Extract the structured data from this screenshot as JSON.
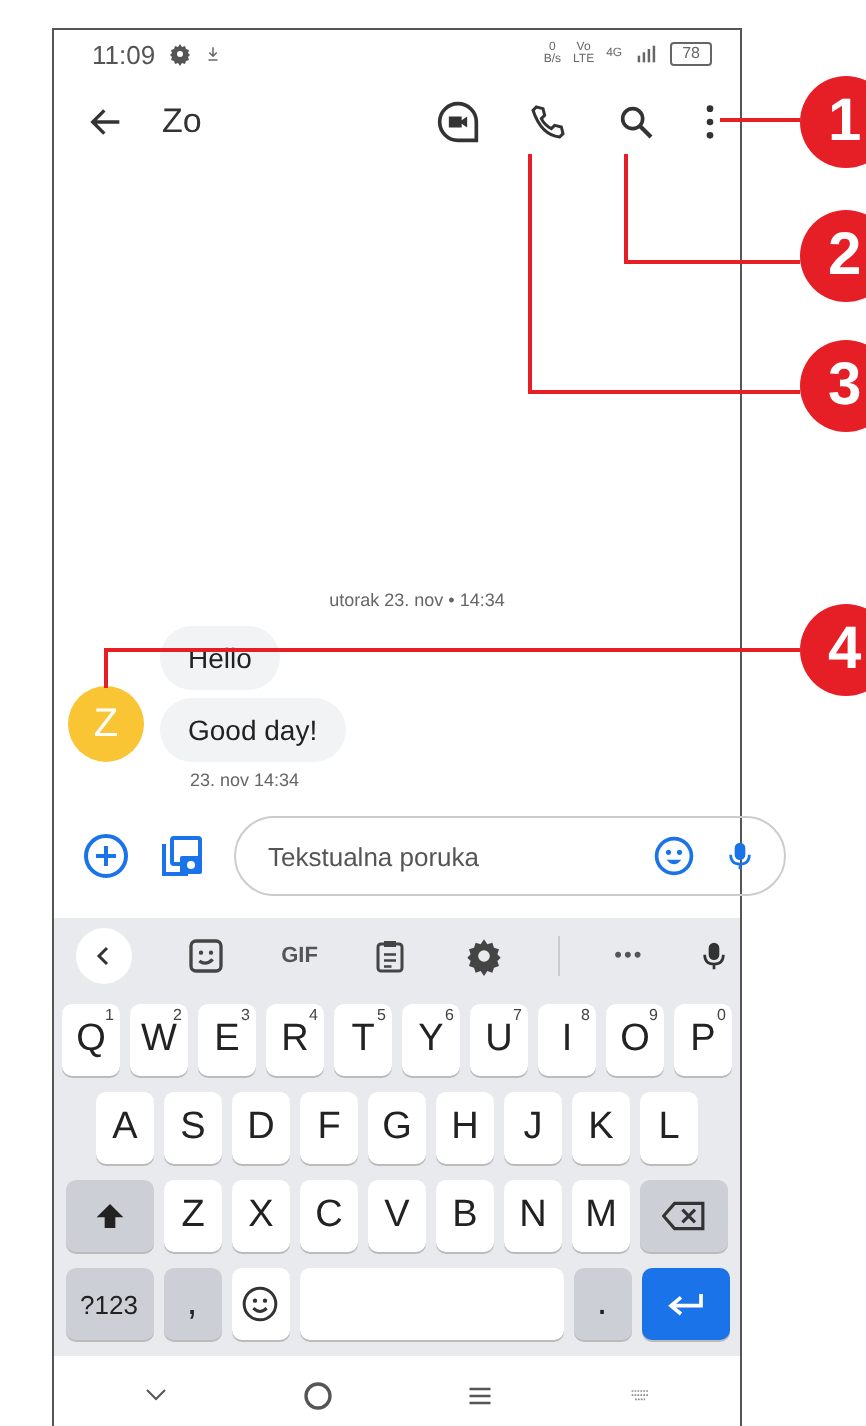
{
  "status_bar": {
    "time": "11:09",
    "speed": [
      "0",
      "B/s"
    ],
    "network": [
      "Vo",
      "LTE"
    ],
    "signal_tag": "4G",
    "battery": "78"
  },
  "app_bar": {
    "title": "Zo"
  },
  "conversation": {
    "date_divider": "utorak 23. nov • 14:34",
    "messages": [
      {
        "text": "Hello"
      },
      {
        "text": "Good day!"
      }
    ],
    "avatar": {
      "initial": "Z",
      "color": "#f9c534"
    },
    "timestamp": "23. nov 14:34"
  },
  "compose": {
    "placeholder": "Tekstualna poruka"
  },
  "keyboard": {
    "toolbar": {
      "gif": "GIF",
      "more": "•••"
    },
    "rows": [
      {
        "keys": [
          {
            "kind": "letter",
            "label": "Q",
            "hint": "1"
          },
          {
            "kind": "letter",
            "label": "W",
            "hint": "2"
          },
          {
            "kind": "letter",
            "label": "E",
            "hint": "3"
          },
          {
            "kind": "letter",
            "label": "R",
            "hint": "4"
          },
          {
            "kind": "letter",
            "label": "T",
            "hint": "5"
          },
          {
            "kind": "letter",
            "label": "Y",
            "hint": "6"
          },
          {
            "kind": "letter",
            "label": "U",
            "hint": "7"
          },
          {
            "kind": "letter",
            "label": "I",
            "hint": "8"
          },
          {
            "kind": "letter",
            "label": "O",
            "hint": "9"
          },
          {
            "kind": "letter",
            "label": "P",
            "hint": "0"
          }
        ]
      },
      {
        "keys": [
          {
            "kind": "letter",
            "label": "A"
          },
          {
            "kind": "letter",
            "label": "S"
          },
          {
            "kind": "letter",
            "label": "D"
          },
          {
            "kind": "letter",
            "label": "F"
          },
          {
            "kind": "letter",
            "label": "G"
          },
          {
            "kind": "letter",
            "label": "H"
          },
          {
            "kind": "letter",
            "label": "J"
          },
          {
            "kind": "letter",
            "label": "K"
          },
          {
            "kind": "letter",
            "label": "L"
          }
        ]
      },
      {
        "keys": [
          {
            "kind": "shift"
          },
          {
            "kind": "letter",
            "label": "Z"
          },
          {
            "kind": "letter",
            "label": "X"
          },
          {
            "kind": "letter",
            "label": "C"
          },
          {
            "kind": "letter",
            "label": "V"
          },
          {
            "kind": "letter",
            "label": "B"
          },
          {
            "kind": "letter",
            "label": "N"
          },
          {
            "kind": "letter",
            "label": "M"
          },
          {
            "kind": "backspace"
          }
        ]
      },
      {
        "keys": [
          {
            "kind": "symbols",
            "label": "?123"
          },
          {
            "kind": "punct",
            "label": ","
          },
          {
            "kind": "emoji"
          },
          {
            "kind": "space"
          },
          {
            "kind": "punct",
            "label": "."
          },
          {
            "kind": "enter"
          }
        ]
      }
    ]
  },
  "callouts": [
    {
      "number": "1"
    },
    {
      "number": "2"
    },
    {
      "number": "3"
    },
    {
      "number": "4"
    }
  ]
}
